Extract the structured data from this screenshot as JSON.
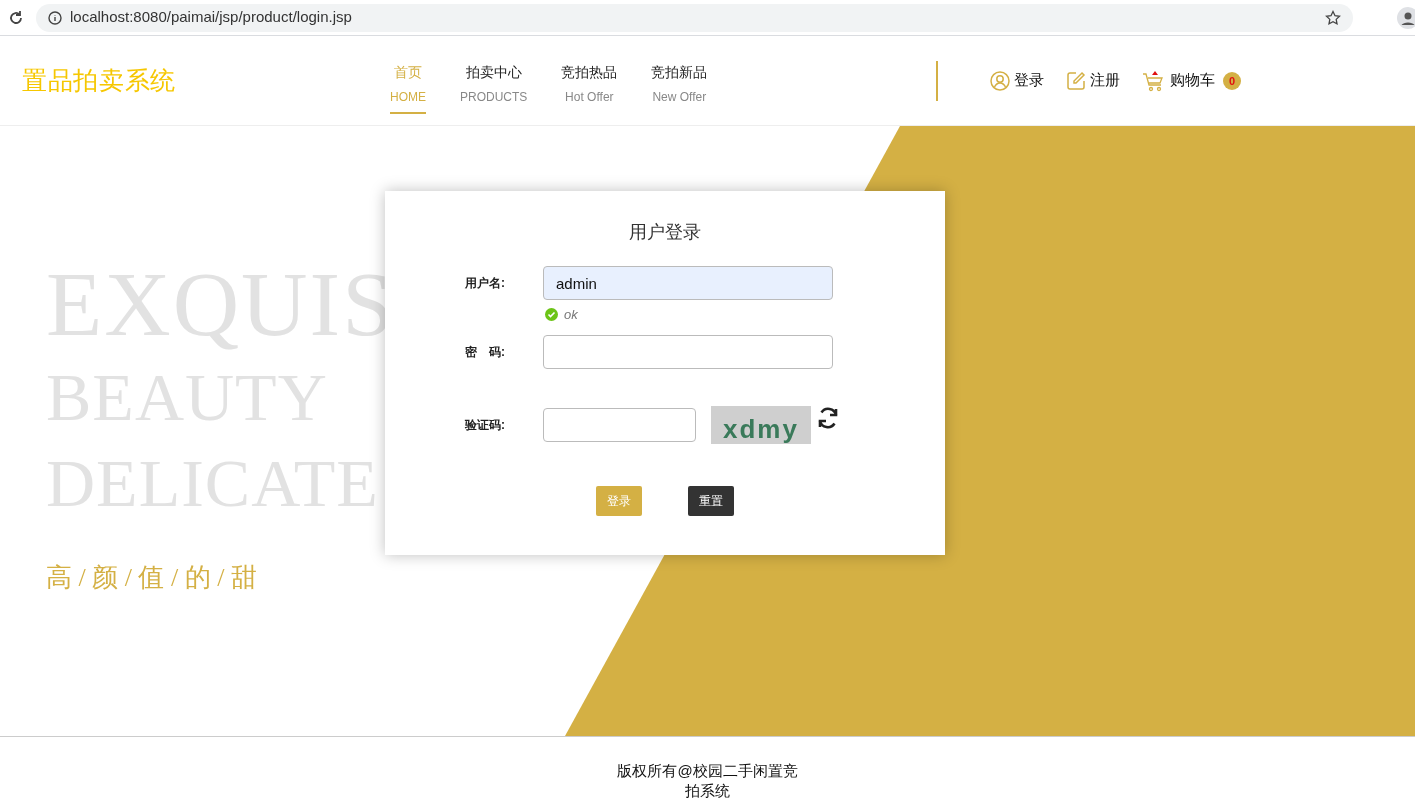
{
  "browser": {
    "url": "localhost:8080/paimai/jsp/product/login.jsp"
  },
  "header": {
    "logo": "置品拍卖系统",
    "nav": [
      {
        "label": "首页",
        "sub": "HOME",
        "selected": true
      },
      {
        "label": "拍卖中心",
        "sub": "PRODUCTS",
        "selected": false
      },
      {
        "label": "竞拍热品",
        "sub": "Hot Offer",
        "selected": false
      },
      {
        "label": "竞拍新品",
        "sub": "New Offer",
        "selected": false
      }
    ],
    "actions": [
      {
        "kind": "user",
        "label": "登录"
      },
      {
        "kind": "edit",
        "label": "注册"
      },
      {
        "kind": "cart",
        "label": "购物车",
        "count": "0"
      }
    ]
  },
  "banner": {
    "lines": [
      "EXQUIS",
      "BEAUTY",
      "DELICATE"
    ],
    "tagline": "高 / 颜 / 值 / 的 / 甜"
  },
  "login": {
    "title": "用户登录",
    "username": {
      "label": "用户名:",
      "value": "admin",
      "hint": "ok"
    },
    "password": {
      "label": "密　码:"
    },
    "captcha": {
      "label": "验证码:",
      "code": "xdmy"
    },
    "buttons": [
      {
        "kind": "primary",
        "label": "登录"
      },
      {
        "kind": "dark",
        "label": "重置"
      }
    ]
  },
  "footer": {
    "text": "版权所有@校园二手闲置竞拍系统"
  }
}
